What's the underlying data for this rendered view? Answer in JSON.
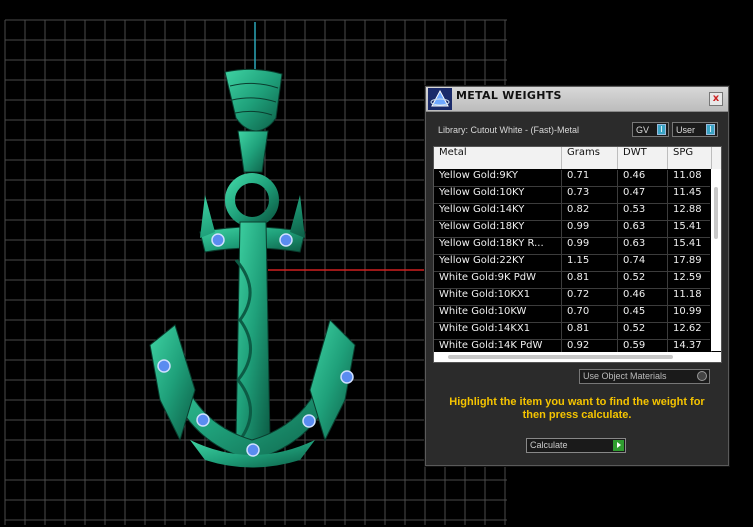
{
  "dialog": {
    "title": "METAL WEIGHTS",
    "close_glyph": "x",
    "library_label": "Library: Cutout White - (Fast)-Metal",
    "gv_label": "GV",
    "user_label": "User",
    "toggle_glyph": "I",
    "columns": [
      "Metal",
      "Grams",
      "DWT",
      "SPG"
    ],
    "rows": [
      {
        "metal": "Yellow Gold:9KY",
        "grams": "0.71",
        "dwt": "0.46",
        "spg": "11.08"
      },
      {
        "metal": "Yellow Gold:10KY",
        "grams": "0.73",
        "dwt": "0.47",
        "spg": "11.45"
      },
      {
        "metal": "Yellow Gold:14KY",
        "grams": "0.82",
        "dwt": "0.53",
        "spg": "12.88"
      },
      {
        "metal": "Yellow Gold:18KY",
        "grams": "0.99",
        "dwt": "0.63",
        "spg": "15.41"
      },
      {
        "metal": "Yellow Gold:18KY R...",
        "grams": "0.99",
        "dwt": "0.63",
        "spg": "15.41"
      },
      {
        "metal": "Yellow Gold:22KY",
        "grams": "1.15",
        "dwt": "0.74",
        "spg": "17.89"
      },
      {
        "metal": "White Gold:9K PdW",
        "grams": "0.81",
        "dwt": "0.52",
        "spg": "12.59"
      },
      {
        "metal": "White Gold:10KX1",
        "grams": "0.72",
        "dwt": "0.46",
        "spg": "11.18"
      },
      {
        "metal": "White Gold:10KW",
        "grams": "0.70",
        "dwt": "0.45",
        "spg": "10.99"
      },
      {
        "metal": "White Gold:14KX1",
        "grams": "0.81",
        "dwt": "0.52",
        "spg": "12.62"
      },
      {
        "metal": "White Gold:14K PdW",
        "grams": "0.92",
        "dwt": "0.59",
        "spg": "14.37"
      }
    ],
    "use_object_materials_label": "Use Object Materials",
    "instruction": "Highlight the item you want to find the weight for then press calculate.",
    "calculate_label": "Calculate"
  },
  "viewport": {
    "model_color": "#1fa07a",
    "grid_color": "#555555",
    "axis_x_color": "#d02020",
    "axis_y_color": "#2aa6b8",
    "background_color": "#000000"
  },
  "colors": {
    "instruction_text": "#f5c400",
    "calculate_arrow": "#2f9d2f",
    "toggle_knob": "#3aa3c3"
  }
}
